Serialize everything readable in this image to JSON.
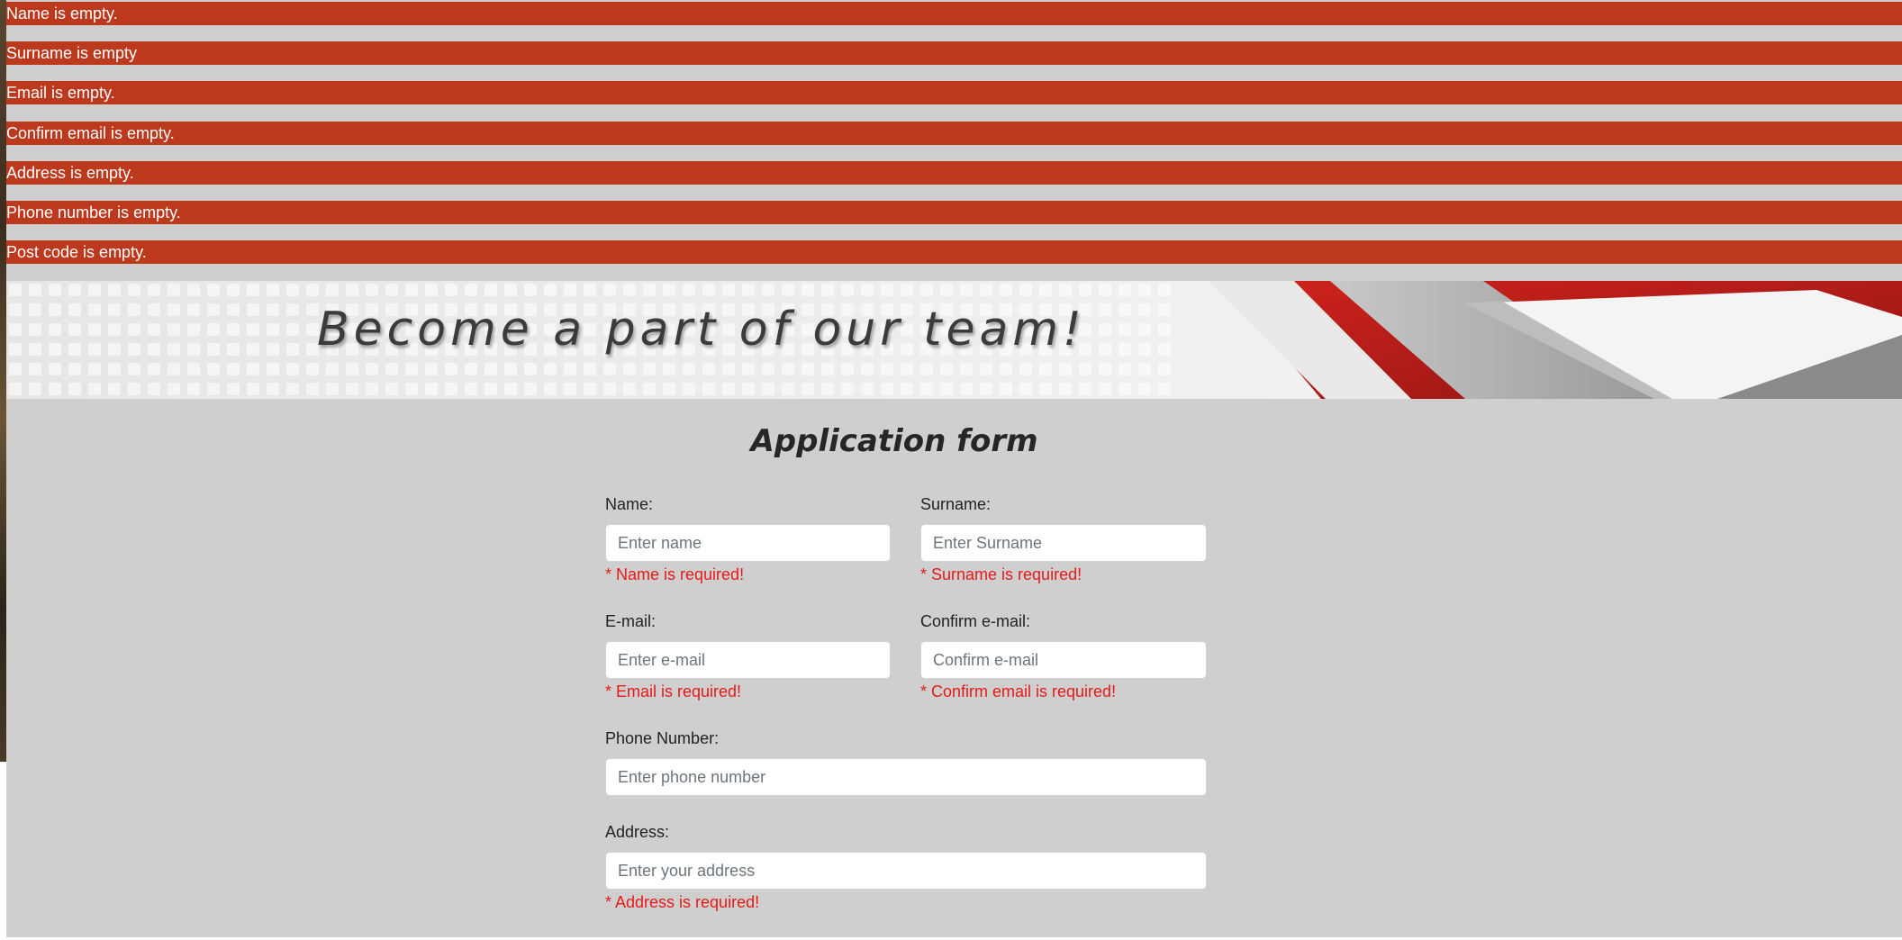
{
  "errors": [
    "Name is empty.",
    "Surname is empty",
    "Email is empty.",
    "Confirm email is empty.",
    "Address is empty.",
    "Phone number is empty.",
    "Post code is empty."
  ],
  "banner": {
    "text": "Become a part of our team!"
  },
  "form": {
    "title": "Application form",
    "name": {
      "label": "Name:",
      "placeholder": "Enter name",
      "error": "* Name is required!"
    },
    "surname": {
      "label": "Surname:",
      "placeholder": "Enter Surname",
      "error": "* Surname is required!"
    },
    "email": {
      "label": "E-mail:",
      "placeholder": "Enter e-mail",
      "error": "* Email is required!"
    },
    "confirm_email": {
      "label": "Confirm e-mail:",
      "placeholder": "Confirm e-mail",
      "error": "* Confirm email is required!"
    },
    "phone": {
      "label": "Phone Number:",
      "placeholder": "Enter phone number"
    },
    "address": {
      "label": "Address:",
      "placeholder": "Enter your address",
      "error": "* Address is required!"
    }
  },
  "colors": {
    "error_bar": "#bc391d",
    "error_text": "#e41b17",
    "page_background": "#cfcfcf"
  }
}
